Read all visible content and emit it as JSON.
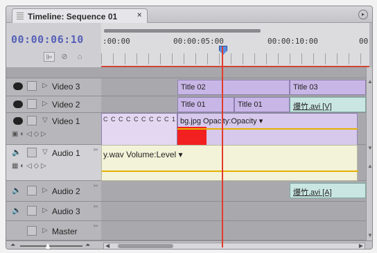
{
  "tab": {
    "title": "Timeline: Sequence 01",
    "close": "×"
  },
  "timecode": "00:00:06:10",
  "ruler": {
    "labels": [
      ":00:00",
      "00:00:05:00",
      "00:00:10:00",
      "00"
    ]
  },
  "icons": {
    "snap": "snap-icon",
    "marker": "marker-icon",
    "keyframe": "keyframe-icon",
    "panel_menu": "panel-menu-icon"
  },
  "tracks": {
    "video": [
      {
        "name": "Video 3"
      },
      {
        "name": "Video 2"
      },
      {
        "name": "Video 1"
      }
    ],
    "audio": [
      {
        "name": "Audio 1"
      },
      {
        "name": "Audio 2"
      },
      {
        "name": "Audio 3"
      },
      {
        "name": "Master"
      }
    ]
  },
  "clips": {
    "video3_a": "Title 02",
    "video3_b": "Title 03",
    "video2_a": "Title 01",
    "video2_b": "Title 01",
    "video2_c": "爆竹.avi [V]",
    "video1_main": "bg.jpg  Opacity:Opacity ▾",
    "video1_frames": [
      "C",
      "C",
      "C",
      "C",
      "C",
      "C",
      "C",
      "C",
      "C",
      "1"
    ],
    "audio1_main": "y.wav  Volume:Level ▾",
    "audio2_c": "爆竹.avi [A]"
  },
  "colors": {
    "title_clip": "#c8b6e6",
    "avi_clip": "#c9e6e2",
    "playhead": "#e23b2b",
    "timecode": "#5660b8",
    "red_region": "#f22020"
  }
}
